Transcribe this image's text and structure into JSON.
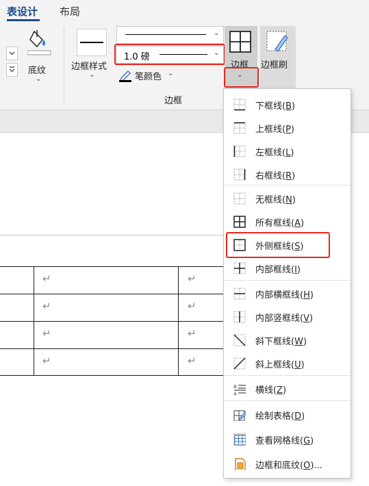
{
  "tabs": {
    "table_design": "表设计",
    "layout": "布局"
  },
  "ribbon": {
    "shading_label": "底纹",
    "border_styles_label": "边框样式",
    "line_weight_value": "1.0 磅",
    "pen_color_label": "笔颜色",
    "borders_label": "边框",
    "border_painter_label": "边框刷",
    "group_label": "边框"
  },
  "menu": {
    "items": [
      {
        "label": "下框线(",
        "key": "B",
        "suffix": ")"
      },
      {
        "label": "上框线(",
        "key": "P",
        "suffix": ")"
      },
      {
        "label": "左框线(",
        "key": "L",
        "suffix": ")"
      },
      {
        "label": "右框线(",
        "key": "R",
        "suffix": ")"
      },
      {
        "label": "无框线(",
        "key": "N",
        "suffix": ")"
      },
      {
        "label": "所有框线(",
        "key": "A",
        "suffix": ")"
      },
      {
        "label": "外侧框线(",
        "key": "S",
        "suffix": ")"
      },
      {
        "label": "内部框线(",
        "key": "I",
        "suffix": ")"
      },
      {
        "label": "内部横框线(",
        "key": "H",
        "suffix": ")"
      },
      {
        "label": "内部竖框线(",
        "key": "V",
        "suffix": ")"
      },
      {
        "label": "斜下框线(",
        "key": "W",
        "suffix": ")"
      },
      {
        "label": "斜上框线(",
        "key": "U",
        "suffix": ")"
      },
      {
        "label": "横线(",
        "key": "Z",
        "suffix": ")"
      },
      {
        "label": "绘制表格(",
        "key": "D",
        "suffix": ")"
      },
      {
        "label": "查看网格线(",
        "key": "G",
        "suffix": ")"
      },
      {
        "label": "边框和底纹(",
        "key": "O",
        "suffix": ")..."
      }
    ]
  },
  "document": {
    "return_mark": "↵"
  },
  "colors": {
    "accent": "#1a4a8c",
    "highlight": "#e8261b",
    "pen": "#000000"
  }
}
